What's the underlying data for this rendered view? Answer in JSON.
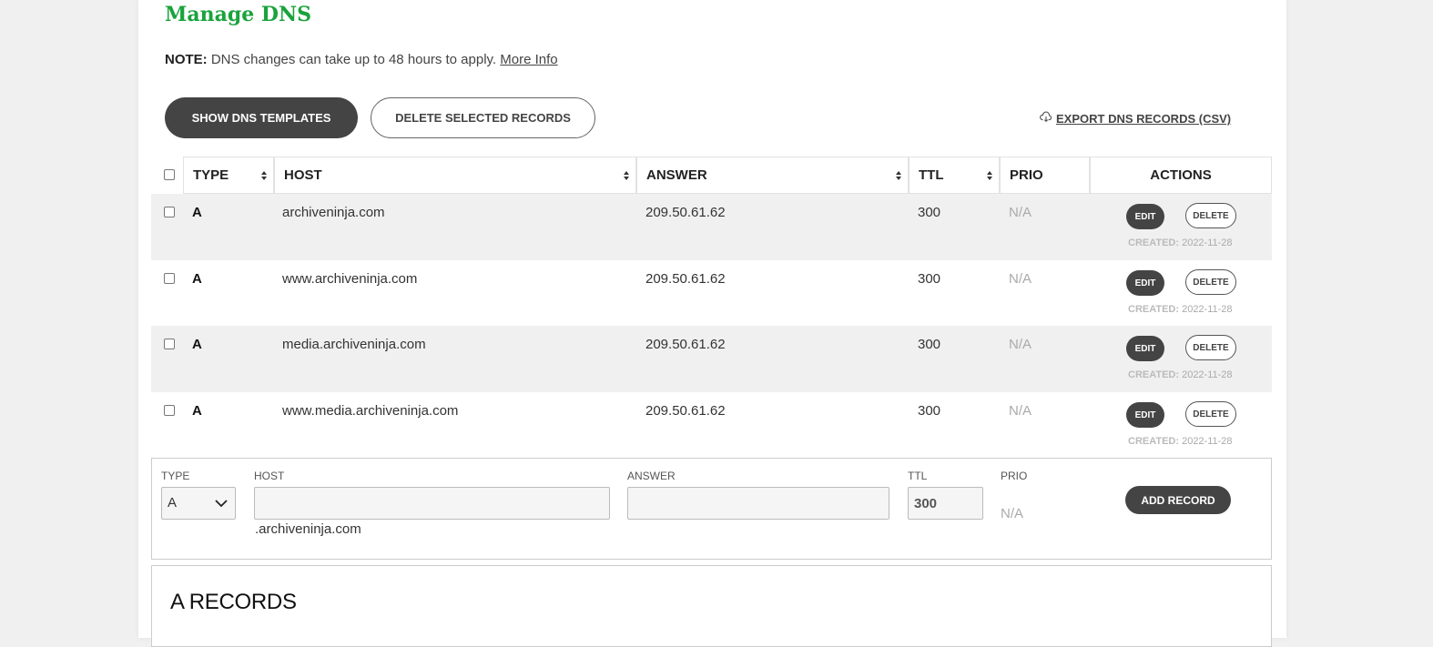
{
  "title": "Manage DNS",
  "note": {
    "label": "NOTE:",
    "text": "DNS changes can take up to 48 hours to apply.",
    "link": "More Info"
  },
  "buttons": {
    "show_templates": "SHOW DNS TEMPLATES",
    "delete_selected": "DELETE SELECTED RECORDS",
    "export": "EXPORT DNS RECORDS (CSV)",
    "export_icon": "cloud-download-icon"
  },
  "table": {
    "headers": {
      "type": "TYPE",
      "host": "HOST",
      "answer": "ANSWER",
      "ttl": "TTL",
      "prio": "PRIO",
      "actions": "ACTIONS"
    },
    "rows": [
      {
        "type": "A",
        "host": "archiveninja.com",
        "answer": "209.50.61.62",
        "ttl": "300",
        "prio": "N/A",
        "created_label": "CREATED:",
        "created": "2022-11-28"
      },
      {
        "type": "A",
        "host": "www.archiveninja.com",
        "answer": "209.50.61.62",
        "ttl": "300",
        "prio": "N/A",
        "created_label": "CREATED:",
        "created": "2022-11-28"
      },
      {
        "type": "A",
        "host": "media.archiveninja.com",
        "answer": "209.50.61.62",
        "ttl": "300",
        "prio": "N/A",
        "created_label": "CREATED:",
        "created": "2022-11-28"
      },
      {
        "type": "A",
        "host": "www.media.archiveninja.com",
        "answer": "209.50.61.62",
        "ttl": "300",
        "prio": "N/A",
        "created_label": "CREATED:",
        "created": "2022-11-28"
      }
    ],
    "edit_label": "EDIT",
    "delete_label": "DELETE"
  },
  "add_form": {
    "type_label": "TYPE",
    "type_value": "A",
    "host_label": "HOST",
    "host_value": "",
    "host_suffix": ".archiveninja.com",
    "answer_label": "ANSWER",
    "answer_value": "",
    "ttl_label": "TTL",
    "ttl_value": "300",
    "prio_label": "PRIO",
    "prio_value": "N/A",
    "add_button": "ADD RECORD"
  },
  "section_title": "A RECORDS",
  "colors": {
    "brand_green": "#1aa33c",
    "dark_button": "#444444",
    "row_shade": "#f0f0f0"
  }
}
